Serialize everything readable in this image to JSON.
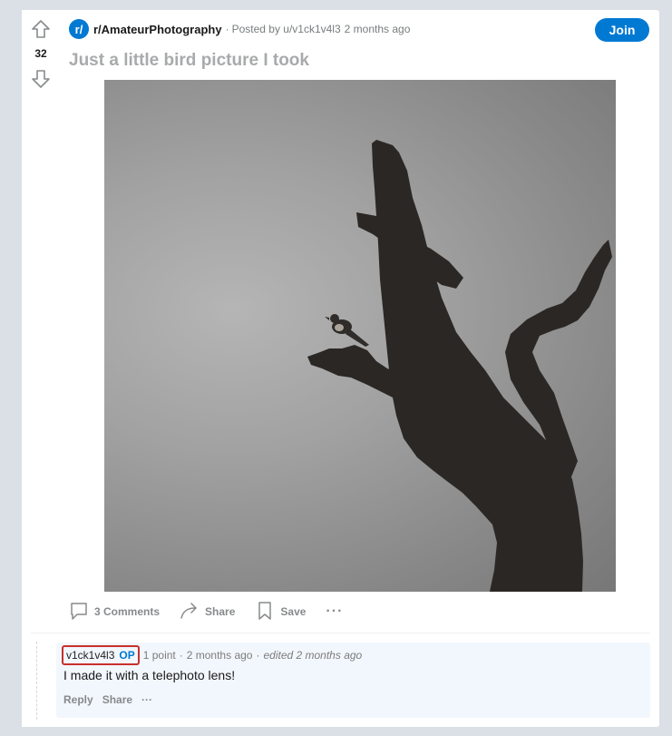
{
  "post": {
    "vote_count": "32",
    "subreddit_icon": "r/",
    "subreddit": "r/AmateurPhotography",
    "separator": "·",
    "posted_by": "Posted by u/v1ck1v4l3",
    "time": "2 months ago",
    "join_label": "Join",
    "title": "Just a little bird picture I took"
  },
  "actions": {
    "comments_label": "3 Comments",
    "share_label": "Share",
    "save_label": "Save",
    "more_label": "···"
  },
  "comment": {
    "author": "v1ck1v4l3",
    "op_badge": "OP",
    "points": "1 point",
    "separator": "·",
    "time": "2 months ago",
    "edited": "edited 2 months ago",
    "body": "I made it with a telephoto lens!",
    "reply_label": "Reply",
    "share_label": "Share",
    "more_label": "···"
  },
  "colors": {
    "accent": "#0079d3",
    "highlight_border": "#c9302c"
  },
  "icons": [
    "upvote-icon",
    "downvote-icon",
    "comment-icon",
    "share-icon",
    "bookmark-icon"
  ]
}
